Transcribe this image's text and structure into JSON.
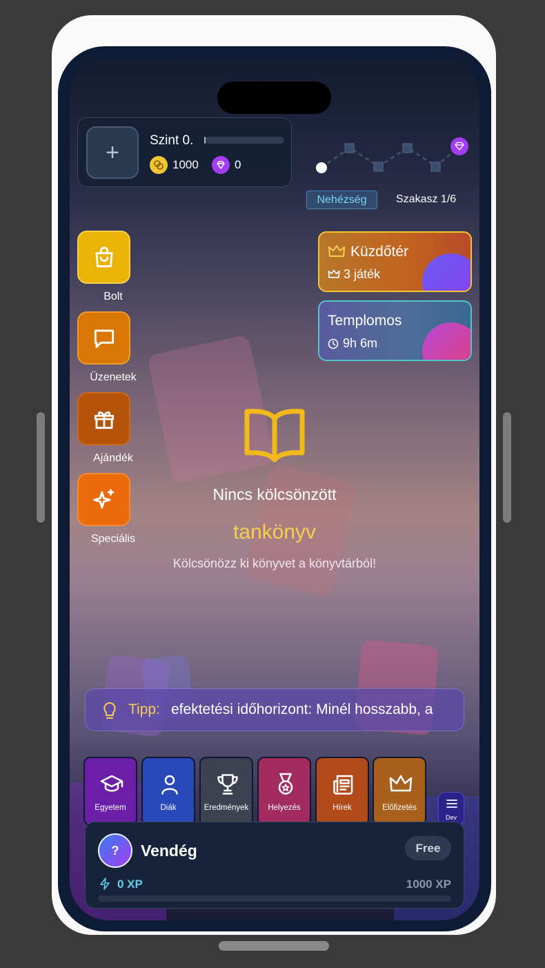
{
  "profile": {
    "level_label": "Szint 0.",
    "level_progress": 0,
    "coins": "1000",
    "gems": "0"
  },
  "progress": {
    "difficulty_label": "Nehézség",
    "stage_label": "Szakasz 1/6"
  },
  "side_menu": [
    {
      "label": "Bolt",
      "icon": "shopping-bag-icon",
      "color": "#eab308"
    },
    {
      "label": "Üzenetek",
      "icon": "message-icon",
      "color": "#d97706"
    },
    {
      "label": "Ajándék",
      "icon": "gift-icon",
      "color": "#b45309"
    },
    {
      "label": "Speciális",
      "icon": "sparkles-icon",
      "color": "#ea6a0c"
    }
  ],
  "events": [
    {
      "title": "Küzdőtér",
      "subtitle": "3 játék",
      "icon": "crown-icon",
      "sub_icon": "crown-icon"
    },
    {
      "title": "Templomos",
      "subtitle": "9h 6m",
      "sub_icon": "clock-icon"
    }
  ],
  "empty_state": {
    "icon": "book-icon",
    "title": "Nincs kölcsönzött",
    "subtitle": "tankönyv",
    "hint": "Kölcsönözz ki könyvet a könyvtárból!"
  },
  "tip": {
    "label": "Tipp:",
    "text": "efektetési időhorizont: Minél hosszabb, a"
  },
  "bottom_nav": [
    {
      "label": "Egyetem",
      "icon": "graduation-cap-icon",
      "color": "#6b1fa8"
    },
    {
      "label": "Diák",
      "icon": "user-icon",
      "color": "#2949b8"
    },
    {
      "label": "Eredmények",
      "icon": "trophy-icon",
      "color": "#3c4250"
    },
    {
      "label": "Helyezés",
      "icon": "medal-icon",
      "color": "#a12a5e"
    },
    {
      "label": "Hírek",
      "icon": "newspaper-icon",
      "color": "#b04a1a"
    },
    {
      "label": "Előfizetés",
      "icon": "crown-icon",
      "color": "#a8601c"
    }
  ],
  "dev_button": {
    "label": "Dev",
    "icon": "menu-icon"
  },
  "user": {
    "avatar_text": "?",
    "name": "Vendég",
    "plan": "Free",
    "xp_current": "0 XP",
    "xp_target": "1000 XP"
  },
  "colors": {
    "accent_yellow": "#f6cf4e",
    "accent_cyan": "#5ad2ee",
    "card_bg": "#17233b"
  }
}
